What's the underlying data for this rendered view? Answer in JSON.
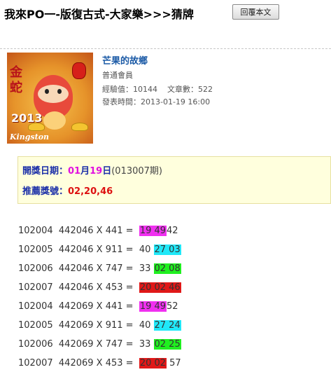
{
  "header": {
    "title": "我來PO一-版復古式-大家樂>>>猜牌",
    "reply_label": "回覆本文"
  },
  "avatar": {
    "year_text": "2013",
    "brand_text": "Kingston",
    "callig_text": "金蛇"
  },
  "user": {
    "name": "芒果的故鄉",
    "rank": "普通會員",
    "exp_label": "經驗值：",
    "exp_value": "10144",
    "posts_label": "文章數：",
    "posts_value": "522",
    "posted_label": "發表時間：",
    "posted_value": "2013-01-19 16:00"
  },
  "draw": {
    "date_label": "開獎日期：",
    "month": "01",
    "month_unit": "月",
    "day": "19",
    "day_unit": "日",
    "period": "(013007期)",
    "rec_label": "推薦獎號：",
    "rec_numbers": "02,20,46"
  },
  "rows": [
    {
      "id": "102004",
      "expr": "442046 X 441 =",
      "pre": "",
      "hl": "19 49",
      "hlcolor": "mag",
      "post": "42"
    },
    {
      "id": "102005",
      "expr": "442046 X 911 =",
      "pre": "40 ",
      "hl": "27 03",
      "hlcolor": "cyan",
      "post": ""
    },
    {
      "id": "102006",
      "expr": "442046 X 747 =",
      "pre": "33 ",
      "hl": "02 08",
      "hlcolor": "green",
      "post": ""
    },
    {
      "id": "102007",
      "expr": "442046 X 453 =",
      "pre": "",
      "hl": "20 02 46",
      "hlcolor": "red",
      "post": ""
    },
    {
      "id": "102004",
      "expr": "442069 X 441 =",
      "pre": "",
      "hl": "19 49",
      "hlcolor": "mag",
      "post": "52"
    },
    {
      "id": "102005",
      "expr": "442069 X 911 =",
      "pre": "40 ",
      "hl": "27 24",
      "hlcolor": "cyan",
      "post": ""
    },
    {
      "id": "102006",
      "expr": "442069 X 747 =",
      "pre": "33 ",
      "hl": "02 25",
      "hlcolor": "green",
      "post": ""
    },
    {
      "id": "102007",
      "expr": "442069 X 453 =",
      "pre": "",
      "hl": "20 02",
      "hlcolor": "red",
      "post": " 57"
    }
  ]
}
